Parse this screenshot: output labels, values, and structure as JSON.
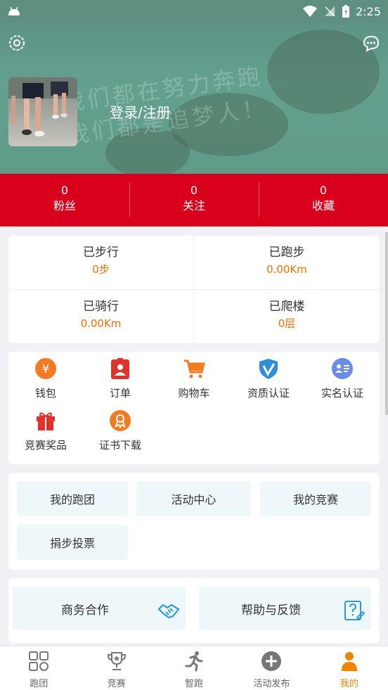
{
  "status_bar": {
    "time": "2:25"
  },
  "header": {
    "login_label": "登录/注册",
    "settings_icon": "gear-icon",
    "message_icon": "chat-bubble-icon",
    "background_scribble": "我们都在努力奔跑",
    "background_scribble2": "我们都是追梦人！"
  },
  "stats": [
    {
      "value": "0",
      "label": "粉丝"
    },
    {
      "value": "0",
      "label": "关注"
    },
    {
      "value": "0",
      "label": "收藏"
    }
  ],
  "activity": [
    {
      "title": "已步行",
      "value": "0步"
    },
    {
      "title": "已跑步",
      "value": "0.00Km"
    },
    {
      "title": "已骑行",
      "value": "0.00Km"
    },
    {
      "title": "已爬楼",
      "value": "0层"
    }
  ],
  "tools": [
    {
      "label": "钱包",
      "icon": "yen-coin-icon"
    },
    {
      "label": "订单",
      "icon": "order-badge-icon"
    },
    {
      "label": "购物车",
      "icon": "shopping-cart-icon"
    },
    {
      "label": "资质认证",
      "icon": "shield-v-icon"
    },
    {
      "label": "实名认证",
      "icon": "id-card-icon"
    },
    {
      "label": "竞赛奖品",
      "icon": "gift-icon"
    },
    {
      "label": "证书下载",
      "icon": "medal-icon"
    }
  ],
  "clubs": [
    {
      "label": "我的跑团"
    },
    {
      "label": "活动中心"
    },
    {
      "label": "我的竞赛"
    },
    {
      "label": "捐步投票"
    }
  ],
  "business": [
    {
      "label": "商务合作",
      "icon": "handshake-icon"
    },
    {
      "label": "帮助与反馈",
      "icon": "help-doc-icon"
    }
  ],
  "tabs": [
    {
      "label": "跑团",
      "icon": "grid-icon",
      "active": false
    },
    {
      "label": "竞赛",
      "icon": "trophy-icon",
      "active": false
    },
    {
      "label": "智跑",
      "icon": "runner-icon",
      "active": false
    },
    {
      "label": "活动发布",
      "icon": "plus-circle-icon",
      "active": false
    },
    {
      "label": "我的",
      "icon": "person-icon",
      "active": true
    }
  ],
  "colors": {
    "accent_red": "#d9001b",
    "accent_orange": "#f07000",
    "hero_green": "#5e8f80",
    "tab_active": "#f08300"
  }
}
